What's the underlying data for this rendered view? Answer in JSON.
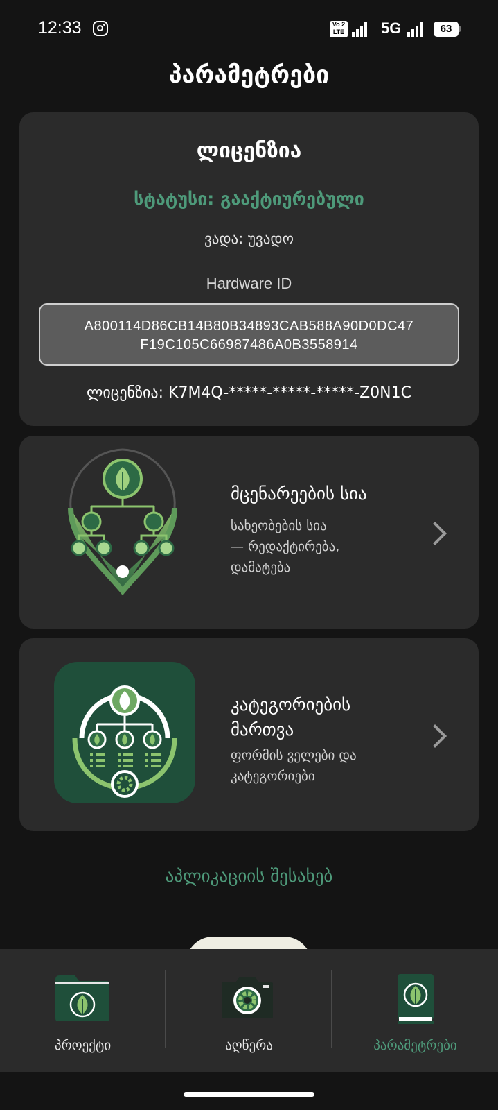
{
  "status_bar": {
    "time": "12:33",
    "volte_top": "Vo 2",
    "volte_bottom": "LTE",
    "network": "5G",
    "battery": "63"
  },
  "header": {
    "title": "პარამეტრები"
  },
  "license": {
    "title": "ლიცენზია",
    "status": "სტატუსი: გააქტიურებული",
    "term": "ვადა: უვადო",
    "hardware_label": "Hardware ID",
    "hardware_id_line1": "A800114D86CB14B80B34893CAB588A90D0DC47",
    "hardware_id_line2": "F19C105C66987486A0B3558914",
    "key": "ლიცენზია: K7M4Q-*****-*****-*****-Z0N1C"
  },
  "menu": {
    "plants": {
      "title": "მცენარეების სია",
      "desc_line1": "სახეობების სია",
      "desc_line2": "— რედაქტირება,",
      "desc_line3": "დამატება"
    },
    "categories": {
      "title_line1": "კატეგორიების",
      "title_line2": "მართვა",
      "desc_line1": "ფორმის ველები და",
      "desc_line2": "კატეგორიები"
    }
  },
  "about": {
    "label": "აპლიკაციის შესახებ"
  },
  "bottom_nav": {
    "items": [
      {
        "label": "პროექტი",
        "icon": "folder-leaf-icon",
        "active": false
      },
      {
        "label": "აღწერა",
        "icon": "camera-leaf-icon",
        "active": false
      },
      {
        "label": "პარამეტრები",
        "icon": "book-leaf-icon",
        "active": true
      }
    ]
  },
  "colors": {
    "background": "#141414",
    "card": "#2b2b2b",
    "accent": "#4e9a7a",
    "icon_green": "#6ea862",
    "icon_dark": "#1f4f3a"
  }
}
